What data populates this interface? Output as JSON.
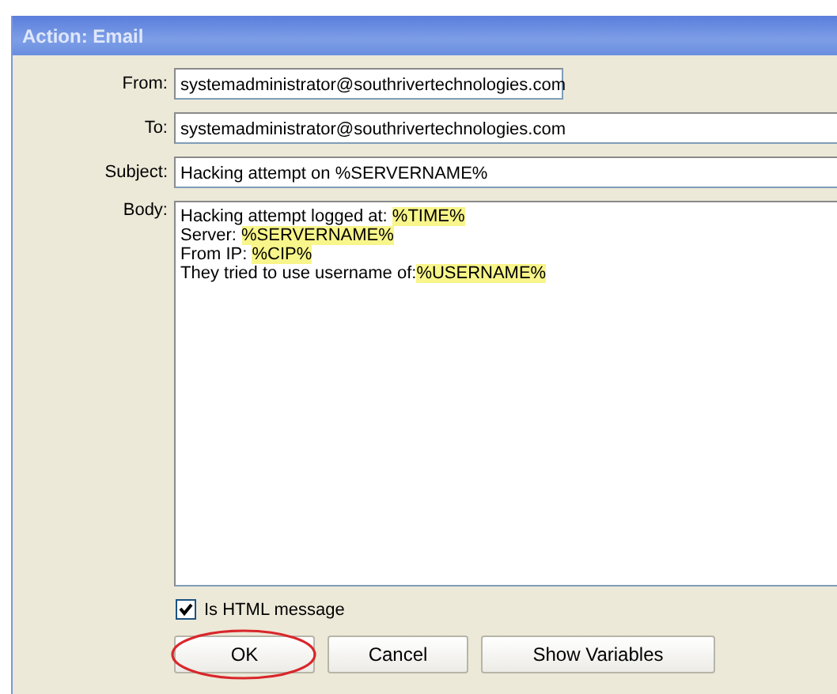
{
  "window": {
    "title": "Action: Email"
  },
  "fields": [
    {
      "label": "From:",
      "value": "systemadministrator@southrivertechnologies.com",
      "kind": "short"
    },
    {
      "label": "To:",
      "value": "systemadministrator@southrivertechnologies.com",
      "kind": "wide"
    },
    {
      "label": "Subject:",
      "value": "Hacking attempt on %SERVERNAME%",
      "kind": "wide"
    }
  ],
  "body": {
    "label": "Body:",
    "lines": [
      [
        {
          "text": "Hacking attempt logged at: ",
          "highlighted": false
        },
        {
          "text": "%TIME%",
          "highlighted": true
        }
      ],
      [
        {
          "text": "Server: ",
          "highlighted": false
        },
        {
          "text": "%SERVERNAME%",
          "highlighted": true
        }
      ],
      [
        {
          "text": "From IP: ",
          "highlighted": false
        },
        {
          "text": "%CIP%",
          "highlighted": true
        }
      ],
      [
        {
          "text": "They tried to use username of:",
          "highlighted": false
        },
        {
          "text": "%USERNAME%",
          "highlighted": true
        }
      ]
    ]
  },
  "html_checkbox": {
    "label": "Is HTML message",
    "checked": true
  },
  "buttons": [
    {
      "label": "OK",
      "circled": true,
      "kind": "narrow"
    },
    {
      "label": "Cancel",
      "circled": false,
      "kind": "narrow"
    },
    {
      "label": "Show Variables",
      "circled": false,
      "kind": "wide"
    }
  ]
}
